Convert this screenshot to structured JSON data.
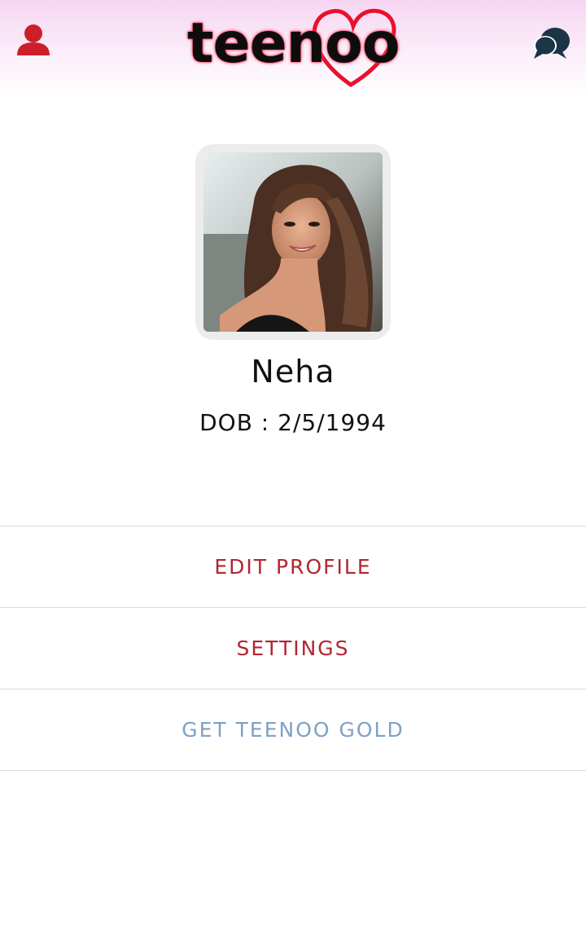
{
  "header": {
    "logo_text": "teenoo",
    "profile_icon": "user-silhouette-icon",
    "chat_icon": "chat-bubbles-icon"
  },
  "profile": {
    "name": "Neha",
    "dob": "DOB : 2/5/1994",
    "photo": "profile-photo"
  },
  "menu": {
    "items": [
      {
        "label": "EDIT PROFILE"
      },
      {
        "label": "SETTINGS"
      },
      {
        "label": "GET TEENOO GOLD"
      }
    ]
  },
  "colors": {
    "accent_red": "#b32531",
    "gold_link": "#7fa1c7",
    "header_top": "#f6d6f1",
    "chat_icon": "#1b3446"
  }
}
